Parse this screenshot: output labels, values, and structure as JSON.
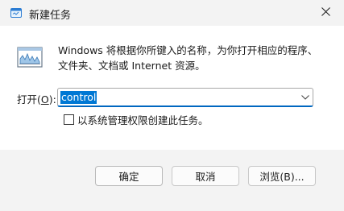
{
  "window": {
    "title": "新建任务",
    "title_icon": "run-dialog-icon",
    "close_icon": "close-icon"
  },
  "main": {
    "icon": "run-program-icon",
    "description_line1": "Windows 将根据你所键入的名称，为你打开相应的程序、",
    "description_line2": "文件夹、文档或 Internet 资源。",
    "open_label_prefix": "打开(",
    "open_label_key": "O",
    "open_label_suffix": "):",
    "open_value": "control",
    "dropdown_icon": "chevron-down-icon",
    "admin_checkbox_label": "以系统管理权限创建此任务。",
    "admin_checked": false
  },
  "buttons": {
    "ok": "确定",
    "cancel": "取消",
    "browse": "浏览(B)..."
  },
  "colors": {
    "accent": "#0078d4",
    "focus_border": "#0067c0",
    "content_bg": "#ffffff",
    "chrome_bg": "#f3f3f3"
  }
}
